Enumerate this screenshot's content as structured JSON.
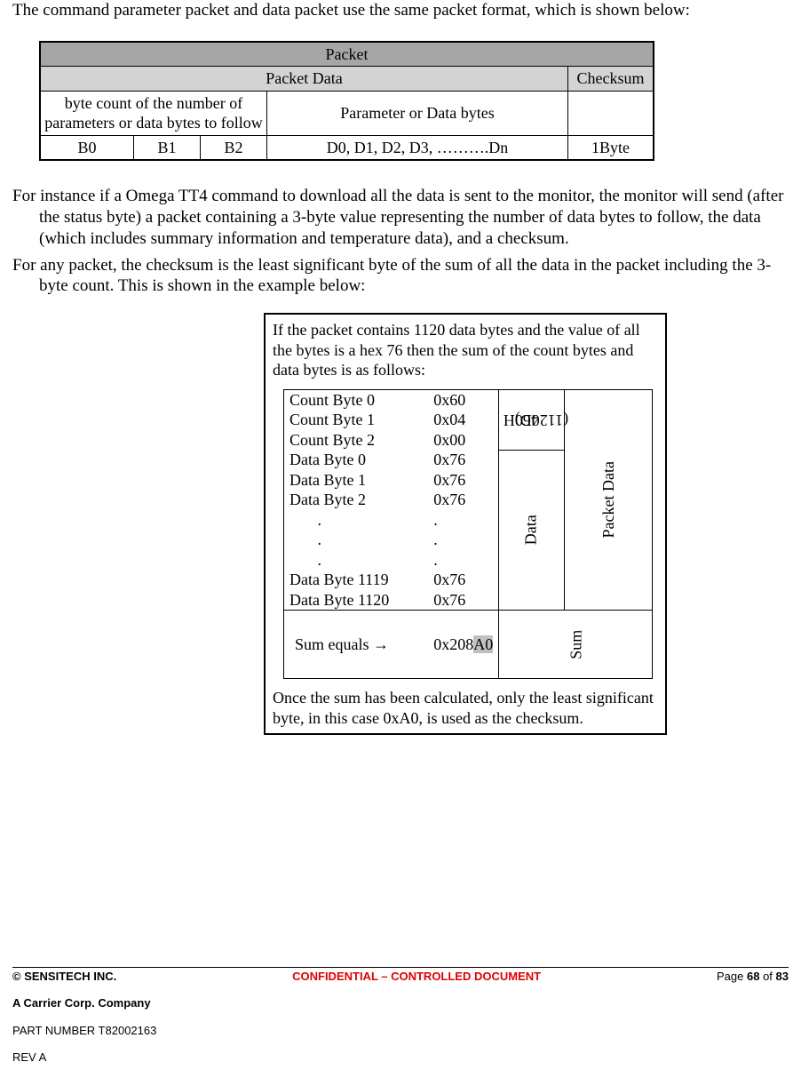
{
  "intro": "The command parameter packet and data packet use the same packet format, which is shown below:",
  "packet_table": {
    "title": "Packet",
    "subheaders": {
      "data": "Packet Data",
      "chk": "Checksum"
    },
    "row1": {
      "count_desc": "byte count of the number of parameters or data bytes to follow",
      "param_desc": "Parameter or Data bytes"
    },
    "row2": {
      "b0": "B0",
      "b1": "B1",
      "b2": "B2",
      "data": "D0, D1, D2, D3, ……….Dn",
      "chk": "1Byte"
    }
  },
  "para2": "For instance if a Omega TT4 command to download all the data is sent to the monitor, the monitor will send (after the status byte) a packet containing a 3-byte value representing the number of data bytes to follow, the data (which includes summary information and temperature data), and a checksum.",
  "para3": "For any packet, the checksum is the least significant byte of the sum of all the data in the packet including the 3-byte count.  This is shown in the example below:",
  "example": {
    "lead": "If the packet contains 1120 data bytes and the value of all the bytes is a hex 76 then the sum of the count bytes and data bytes is as follows:",
    "rows": [
      {
        "l": "Count Byte 0",
        "v": "0x60"
      },
      {
        "l": "Count Byte 1",
        "v": "0x04"
      },
      {
        "l": "Count Byte 2",
        "v": "0x00"
      },
      {
        "l": "Data Byte 0",
        "v": "0x76"
      },
      {
        "l": "Data Byte 1",
        "v": "0x76"
      },
      {
        "l": "Data Byte 2",
        "v": "0x76"
      },
      {
        "l": "       .",
        "v": "."
      },
      {
        "l": "       .",
        "v": "."
      },
      {
        "l": "       .",
        "v": "."
      },
      {
        "l": "Data Byte 1119",
        "v": "0x76"
      },
      {
        "l": "Data Byte 1120",
        "v": "0x76"
      }
    ],
    "side1_a": "460H",
    "side1_b": "(1120D)",
    "side2": "Data",
    "side3": "Packet Data",
    "sum_label": "Sum equals →",
    "sum_prefix": "0x208",
    "sum_hl": "A0",
    "sum_side": "Sum",
    "trail": "Once the sum has been calculated, only the least significant byte, in this case 0xA0, is used as the checksum."
  },
  "footer": {
    "copyright": "© SENSITECH INC.",
    "conf": "CONFIDENTIAL – CONTROLLED DOCUMENT",
    "page_prefix": "Page ",
    "page_num": "68",
    "page_mid": " of ",
    "page_total": "83",
    "company": "A Carrier Corp. Company",
    "part": "PART NUMBER T82002163",
    "rev": "REV A"
  }
}
